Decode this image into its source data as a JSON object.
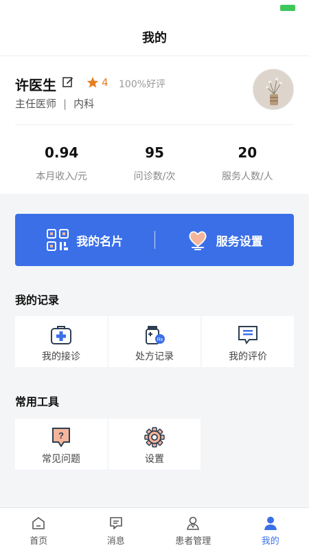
{
  "nav": {
    "title": "我的"
  },
  "profile": {
    "name": "许医生",
    "rating": "4",
    "praise": "100%好评",
    "position": "主任医师",
    "separator": "|",
    "department": "内科"
  },
  "stats": [
    {
      "value": "0.94",
      "label": "本月收入/元"
    },
    {
      "value": "95",
      "label": "问诊数/次"
    },
    {
      "value": "20",
      "label": "服务人数/人"
    }
  ],
  "actions": {
    "card": "我的名片",
    "service": "服务设置"
  },
  "records": {
    "title": "我的记录",
    "items": [
      {
        "label": "我的接诊",
        "icon": "medical-kit-icon"
      },
      {
        "label": "处方记录",
        "icon": "prescription-bottle-icon"
      },
      {
        "label": "我的评价",
        "icon": "review-message-icon"
      }
    ]
  },
  "tools": {
    "title": "常用工具",
    "items": [
      {
        "label": "常见问题",
        "icon": "faq-icon"
      },
      {
        "label": "设置",
        "icon": "gear-icon"
      }
    ]
  },
  "tabbar": {
    "items": [
      {
        "label": "首页",
        "icon": "home-icon"
      },
      {
        "label": "消息",
        "icon": "message-icon"
      },
      {
        "label": "患者管理",
        "icon": "patient-icon"
      },
      {
        "label": "我的",
        "icon": "profile-icon",
        "active": true
      }
    ]
  },
  "colors": {
    "accent": "#3a6fe8",
    "star": "#e67e22",
    "icon_peach": "#f5b59a",
    "icon_dark": "#2c3e50"
  }
}
